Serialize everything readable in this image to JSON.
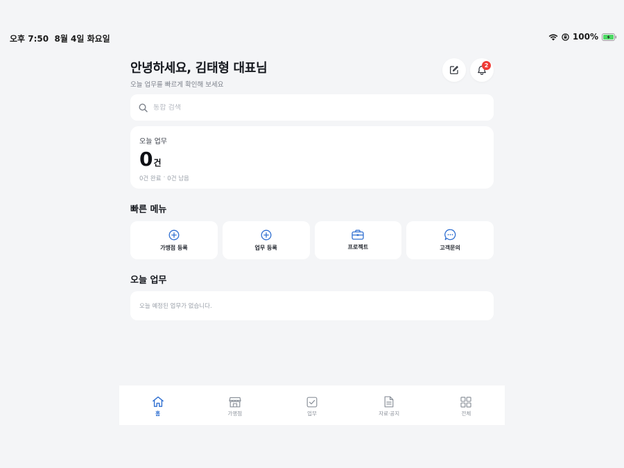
{
  "status_bar": {
    "time": "오후 7:50",
    "date": "8월 4일 화요일",
    "battery": "100%"
  },
  "header": {
    "greeting": "안녕하세요, 김태형 대표님",
    "subtitle": "오늘 업무를 빠르게 확인해 보세요",
    "notification_count": "2"
  },
  "search": {
    "placeholder": "통합 검색"
  },
  "today_summary": {
    "label": "오늘 업무",
    "count": "0",
    "unit": "건",
    "done": "0건 완료",
    "separator": "·",
    "remaining": "0건 남음"
  },
  "quick_menu": {
    "title": "빠른 메뉴",
    "items": [
      {
        "label": "가맹점 등록",
        "icon": "plus-circle-icon"
      },
      {
        "label": "업무 등록",
        "icon": "plus-circle-icon"
      },
      {
        "label": "프로젝트",
        "icon": "briefcase-icon"
      },
      {
        "label": "고객문의",
        "icon": "chat-bubble-icon"
      }
    ]
  },
  "today_tasks": {
    "title": "오늘 업무",
    "empty_message": "오늘 예정된 업무가 없습니다."
  },
  "tab_bar": {
    "tabs": [
      {
        "label": "홈",
        "icon": "home-icon",
        "active": true
      },
      {
        "label": "가맹점",
        "icon": "store-icon",
        "active": false
      },
      {
        "label": "업무",
        "icon": "checkbox-icon",
        "active": false
      },
      {
        "label": "자료·공지",
        "icon": "document-icon",
        "active": false
      },
      {
        "label": "전체",
        "icon": "grid-icon",
        "active": false
      }
    ]
  },
  "colors": {
    "accent": "#2f6fd1",
    "badge": "#ef3b36",
    "background": "#f4f5f7",
    "battery": "#4cd964"
  }
}
